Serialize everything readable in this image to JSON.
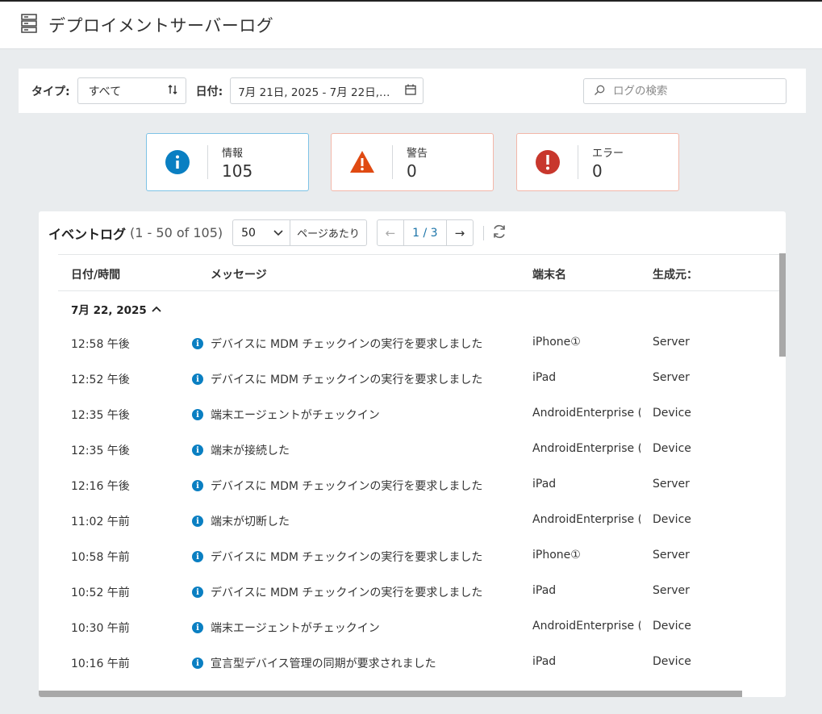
{
  "header": {
    "title": "デプロイメントサーバーログ",
    "icon": "server-icon"
  },
  "filters": {
    "type_label": "タイプ:",
    "type_value": "すべて",
    "date_label": "日付:",
    "date_value": "7月 21日, 2025 - 7月 22日,…",
    "search_placeholder": "ログの検索"
  },
  "summary": {
    "info": {
      "label": "情報",
      "count": "105",
      "color": "#0a7fc2"
    },
    "warning": {
      "label": "警告",
      "count": "0",
      "color": "#e04a12"
    },
    "error": {
      "label": "エラー",
      "count": "0",
      "color": "#c8372d"
    }
  },
  "eventlog": {
    "title": "イベントログ",
    "range": "(1 - 50 of 105)",
    "per_page_value": "50",
    "per_page_label": "ページあたり",
    "page_indicator": "1 / 3",
    "columns": [
      "日付/時間",
      "メッセージ",
      "端末名",
      "生成元："
    ],
    "group_label": "7月 22, 2025",
    "rows": [
      {
        "time": "12:58 午後",
        "message": "デバイスに MDM チェックインの実行を要求しました",
        "device": "iPhone①",
        "source": "Server"
      },
      {
        "time": "12:52 午後",
        "message": "デバイスに MDM チェックインの実行を要求しました",
        "device": "iPad",
        "source": "Server"
      },
      {
        "time": "12:35 午後",
        "message": "端末エージェントがチェックイン",
        "device": "AndroidEnterprise (",
        "source": "Device"
      },
      {
        "time": "12:35 午後",
        "message": "端末が接続した",
        "device": "AndroidEnterprise (",
        "source": "Device"
      },
      {
        "time": "12:16 午後",
        "message": "デバイスに MDM チェックインの実行を要求しました",
        "device": "iPad",
        "source": "Server"
      },
      {
        "time": "11:02 午前",
        "message": "端末が切断した",
        "device": "AndroidEnterprise (",
        "source": "Device"
      },
      {
        "time": "10:58 午前",
        "message": "デバイスに MDM チェックインの実行を要求しました",
        "device": "iPhone①",
        "source": "Server"
      },
      {
        "time": "10:52 午前",
        "message": "デバイスに MDM チェックインの実行を要求しました",
        "device": "iPad",
        "source": "Server"
      },
      {
        "time": "10:30 午前",
        "message": "端末エージェントがチェックイン",
        "device": "AndroidEnterprise (",
        "source": "Device"
      },
      {
        "time": "10:16 午前",
        "message": "宣言型デバイス管理の同期が要求されました",
        "device": "iPad",
        "source": "Device"
      }
    ]
  }
}
